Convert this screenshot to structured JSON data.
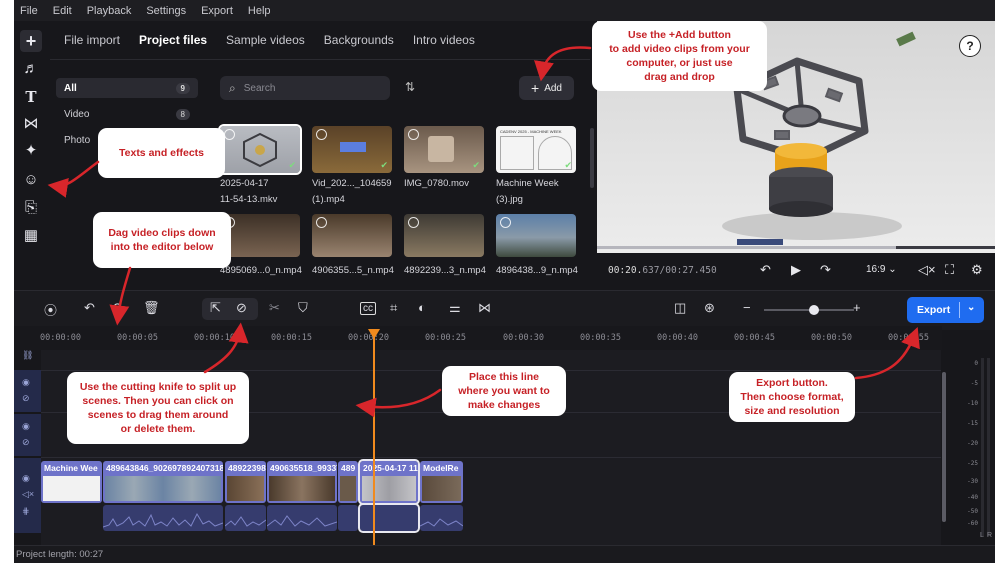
{
  "menu": [
    "File",
    "Edit",
    "Playback",
    "Settings",
    "Export",
    "Help"
  ],
  "media": {
    "tabs": [
      "File import",
      "Project files",
      "Sample videos",
      "Backgrounds",
      "Intro videos"
    ],
    "categories": [
      {
        "label": "All",
        "count": "9"
      },
      {
        "label": "Video",
        "count": "8"
      },
      {
        "label": "Photo",
        "count": ""
      }
    ],
    "search_placeholder": "Search",
    "add_label": "Add",
    "items": [
      {
        "name": "2025-04-17 11-54-13.mkv",
        "line1": "2025-04-17",
        "line2": "11-54-13.mkv"
      },
      {
        "name": "Vid_202..._104659 (1).mp4",
        "line1": "Vid_202..._104659",
        "line2": "(1).mp4"
      },
      {
        "name": "IMG_0780.mov",
        "line1": "IMG_0780.mov",
        "line2": ""
      },
      {
        "name": "Machine Week (3).jpg",
        "line1": "Machine Week",
        "line2": "(3).jpg"
      },
      {
        "name": "4895069...0_n.mp4",
        "line1": "4895069...0_n.mp4",
        "line2": ""
      },
      {
        "name": "4906355...5_n.mp4",
        "line1": "4906355...5_n.mp4",
        "line2": ""
      },
      {
        "name": "4892239...3_n.mp4",
        "line1": "4892239...3_n.mp4",
        "line2": ""
      },
      {
        "name": "4896438...9_n.mp4",
        "line1": "4896438...9_n.mp4",
        "line2": ""
      }
    ],
    "thumb_caption": "CADENV 2025 - MACHINE WEEK"
  },
  "player": {
    "current": "00:20.",
    "current_ms": "637",
    "total": "/00:27.450",
    "ratio": "16:9"
  },
  "timeline": {
    "export_label": "Export",
    "ruler": [
      "00:00:00",
      "00:00:05",
      "00:00:10",
      "00:00:15",
      "00:00:20",
      "00:00:25",
      "00:00:30",
      "00:00:35",
      "00:00:40",
      "00:00:45",
      "00:00:50",
      "00:00:55"
    ],
    "clips": [
      "Machine Wee",
      "489643846_9026978924073188_",
      "48922398",
      "490635518_99337",
      "489",
      "2025-04-17 11",
      "ModelRe"
    ],
    "project_length": "Project length: 00:27"
  },
  "meter": {
    "labels": [
      "0",
      "-5",
      "-10",
      "-15",
      "-20",
      "-25",
      "-30",
      "-40",
      "-50",
      "-60"
    ],
    "left": "L",
    "right": "R"
  },
  "annotations": {
    "add": "Use the +Add button\nto add video clips from your\ncomputer, or just use\ndrag and drop",
    "texts": "Texts and effects",
    "drag": "Dag video clips down\ninto the editor below",
    "knife": "Use the cutting knife to split up\nscenes. Then you can click on\nscenes to drag them around\nor delete them.",
    "line": "Place this line\nwhere you want to\nmake changes",
    "export": "Export button.\nThen choose format,\nsize and resolution"
  },
  "colors": {
    "accent": "#1f6cf0",
    "playhead": "#f08a1e",
    "clip": "#6e73c9",
    "annotation_text": "#c62126"
  },
  "icons": [
    "plus-icon",
    "music-icon",
    "text-icon",
    "transition-icon",
    "effects-icon",
    "sticker-icon",
    "overlay-icon",
    "widgets-icon",
    "search-icon",
    "sort-icon",
    "help-icon",
    "undo-icon",
    "delete-icon",
    "select-icon",
    "knife-icon",
    "scissors-icon",
    "marker-icon",
    "captions-icon",
    "crop-icon",
    "color-icon",
    "adjust-icon",
    "speed-icon",
    "audio-icon",
    "fullscreen-icon",
    "settings-icon",
    "eye-icon",
    "hidden-icon",
    "mute-icon"
  ]
}
